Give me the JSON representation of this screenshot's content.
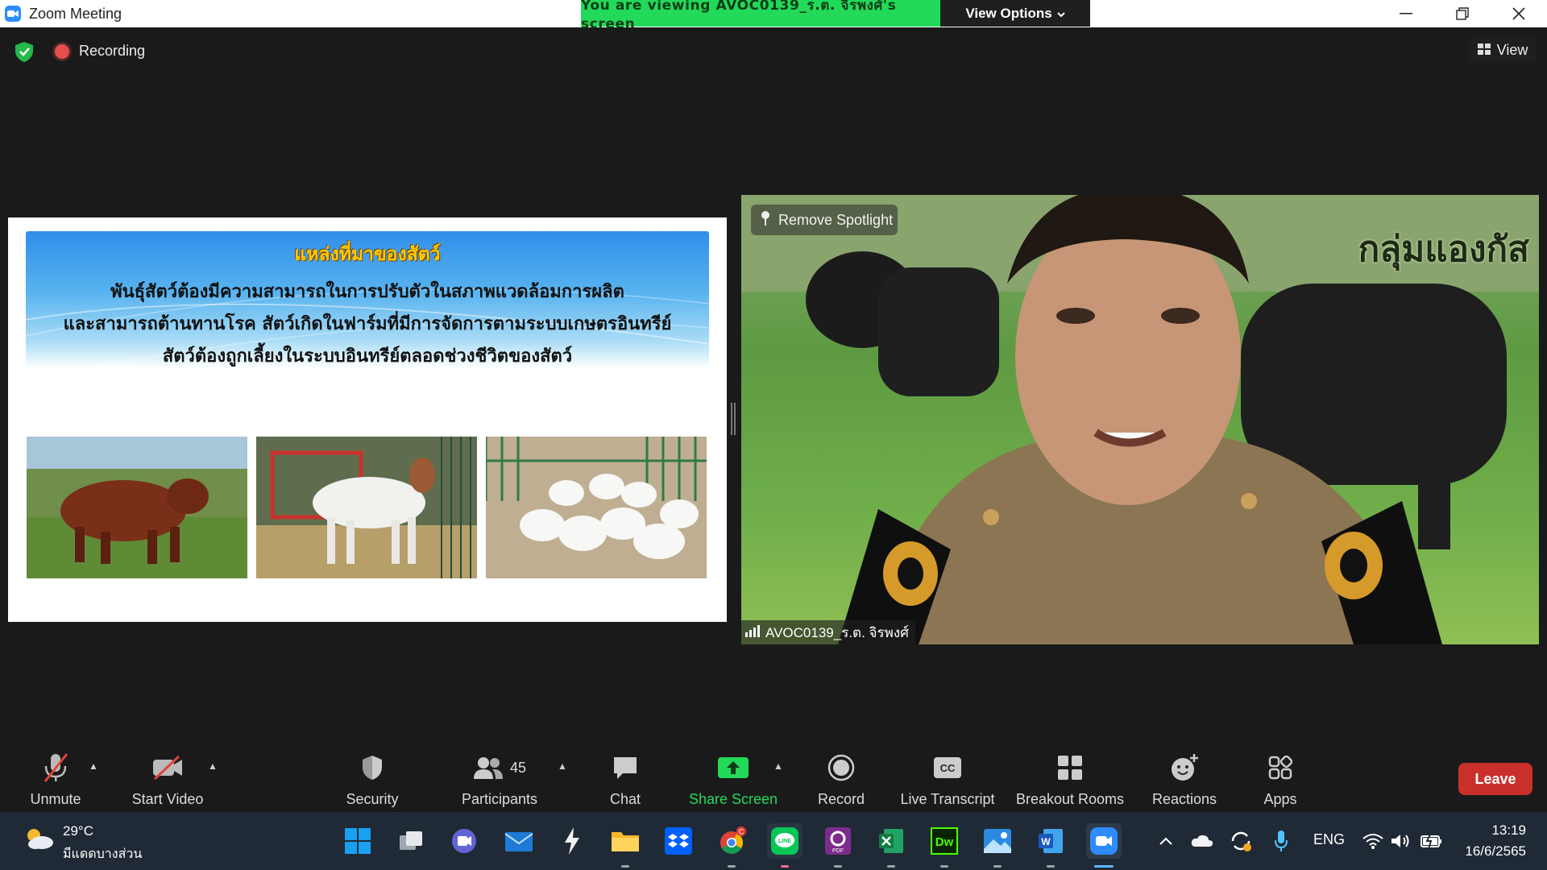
{
  "window": {
    "title": "Zoom Meeting",
    "viewing_banner": "You are viewing AVOC0139_ร.ต. จิรพงศ์'s screen",
    "view_options_label": "View Options"
  },
  "top_bar": {
    "recording_label": "Recording",
    "view_label": "View"
  },
  "shared_screen": {
    "slide_title": "แหล่งที่มาของสัตว์",
    "slide_lines": [
      "พันธุ์สัตว์ต้องมีความสามารถในการปรับตัวในสภาพแวดล้อมการผลิต",
      "และสามารถต้านทานโรค สัตว์เกิดในฟาร์มที่มีการจัดการตามระบบเกษตรอินทรีย์",
      "สัตว์ต้องถูกเลี้ยงในระบบอินทรีย์ตลอดช่วงชีวิตของสัตว์"
    ],
    "photos": [
      "brown-cattle",
      "white-goat",
      "white-ducks"
    ]
  },
  "video": {
    "spotlight_label": "Remove Spotlight",
    "background_caption": "กลุ่มแองกัส",
    "participant_name": "AVOC0139_ร.ต. จิรพงศ์"
  },
  "controls": {
    "unmute": "Unmute",
    "start_video": "Start Video",
    "security": "Security",
    "participants": "Participants",
    "participants_count": "45",
    "chat": "Chat",
    "share_screen": "Share Screen",
    "record": "Record",
    "live_transcript": "Live Transcript",
    "breakout_rooms": "Breakout Rooms",
    "reactions": "Reactions",
    "apps": "Apps",
    "leave": "Leave"
  },
  "taskbar": {
    "temperature": "29°C",
    "weather_desc": "มีแดดบางส่วน",
    "language": "ENG",
    "time": "13:19",
    "date": "16/6/2565",
    "chrome_badge": "C"
  },
  "colors": {
    "zoom_blue": "#2d8cff",
    "banner_green": "#23d959",
    "share_green": "#23d959",
    "leave_red": "#c9302c",
    "taskbar": "#202a36"
  }
}
